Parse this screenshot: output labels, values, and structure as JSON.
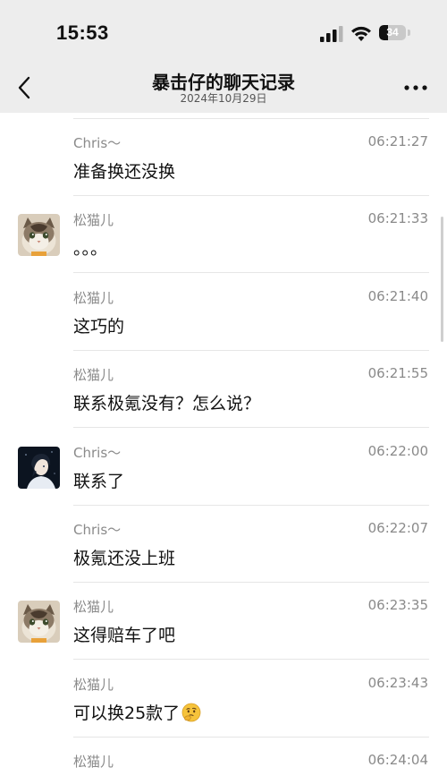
{
  "status_bar": {
    "time": "15:53",
    "battery_percent": 34,
    "battery_label": "34"
  },
  "nav": {
    "title": "暴击仔的聊天记录",
    "subtitle": "2024年10月29日"
  },
  "messages": [
    {
      "sender": "Chris～",
      "time": "06:21:27",
      "text": "准备换还没换",
      "avatar": "",
      "emoji": ""
    },
    {
      "sender": "松猫儿",
      "time": "06:21:33",
      "text": "。。。",
      "avatar": "cat-avatar",
      "emoji": ""
    },
    {
      "sender": "松猫儿",
      "time": "06:21:40",
      "text": "这巧的",
      "avatar": "",
      "emoji": ""
    },
    {
      "sender": "松猫儿",
      "time": "06:21:55",
      "text": "联系极氪没有？怎么说？",
      "avatar": "",
      "emoji": ""
    },
    {
      "sender": "Chris～",
      "time": "06:22:00",
      "text": "联系了",
      "avatar": "anime-avatar",
      "emoji": ""
    },
    {
      "sender": "Chris～",
      "time": "06:22:07",
      "text": "极氪还没上班",
      "avatar": "",
      "emoji": ""
    },
    {
      "sender": "松猫儿",
      "time": "06:23:35",
      "text": "这得赔车了吧",
      "avatar": "cat-avatar",
      "emoji": ""
    },
    {
      "sender": "松猫儿",
      "time": "06:23:43",
      "text": "可以换25款了",
      "avatar": "",
      "emoji": "thinking-face-icon"
    },
    {
      "sender": "松猫儿",
      "time": "06:24:04",
      "text": "",
      "avatar": "",
      "emoji": ""
    }
  ],
  "colors": {
    "header_bg": "#ededed",
    "meta_text": "#8a8a8a",
    "divider": "#e6e6e6"
  }
}
